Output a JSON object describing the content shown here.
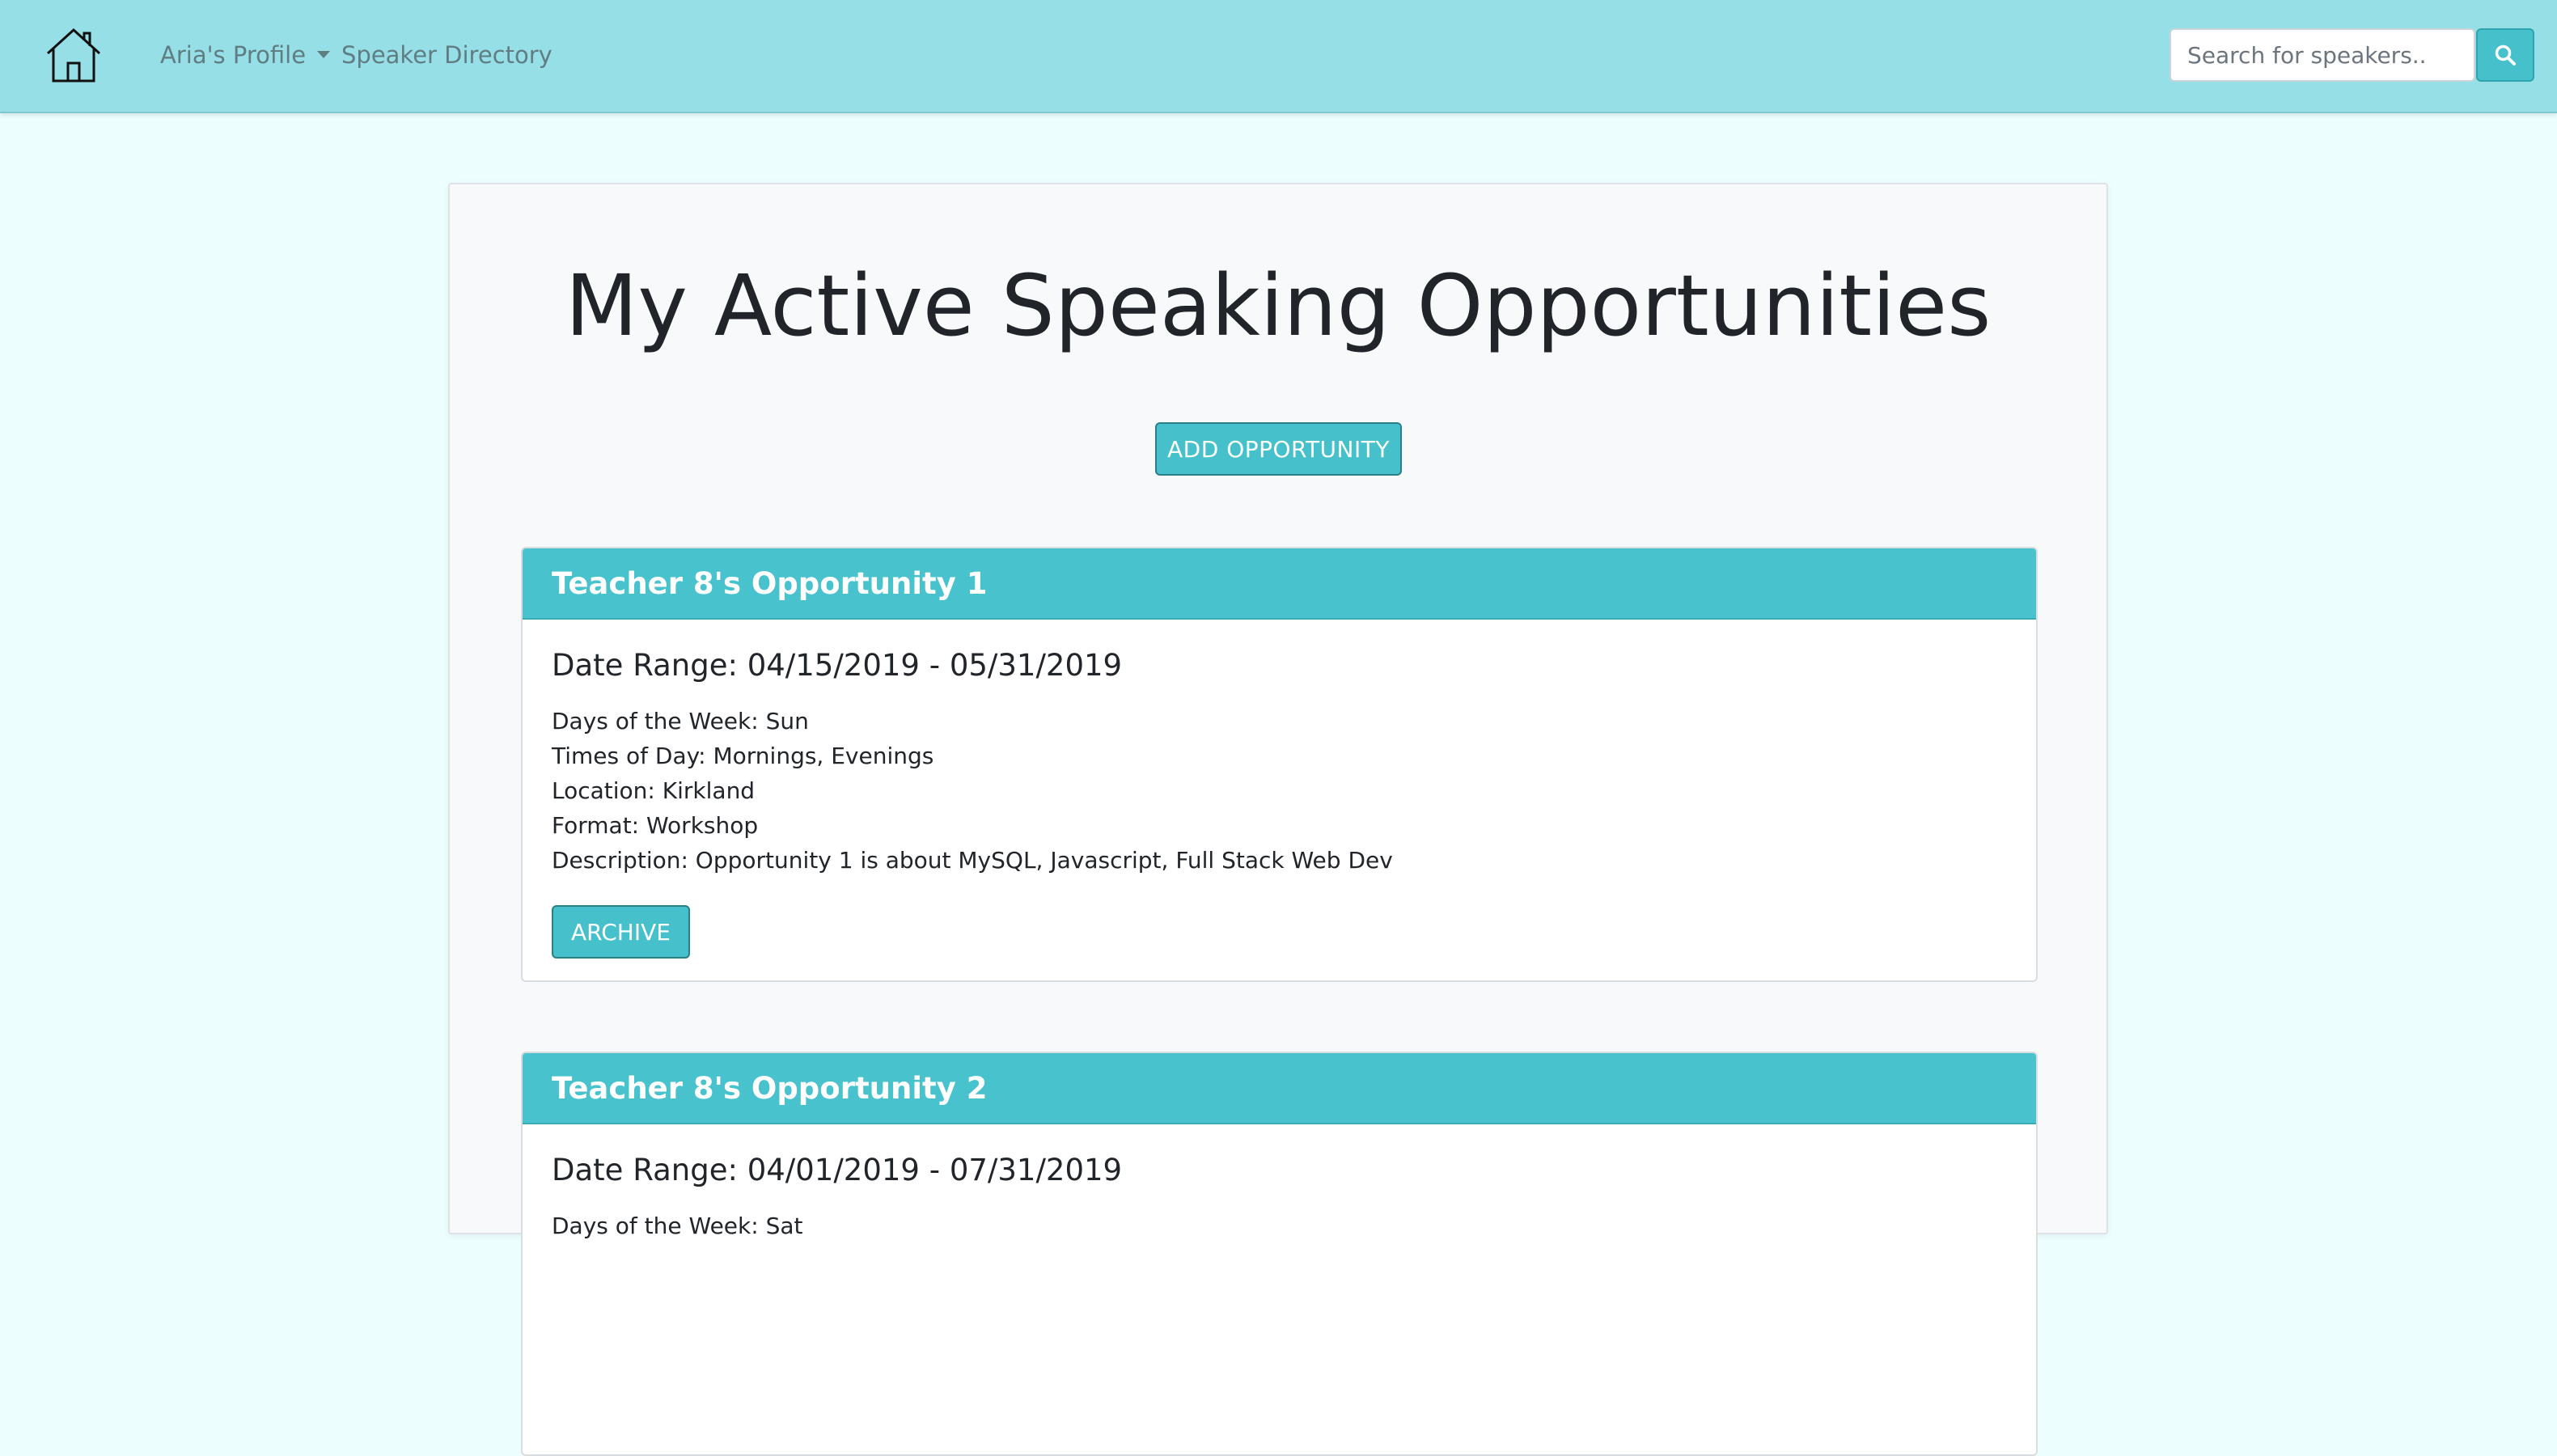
{
  "navbar": {
    "home_icon": "house-icon",
    "profile_label": "Aria's Profile",
    "directory_label": "Speaker Directory",
    "search_placeholder": "Search for speakers..",
    "search_icon": "search-icon"
  },
  "main": {
    "title": "My Active Speaking Opportunities",
    "add_button_label": "ADD OPPORTUNITY"
  },
  "opportunities": [
    {
      "title": "Teacher 8's Opportunity 1",
      "date_range": "Date Range: 04/15/2019 - 05/31/2019",
      "days": "Days of the Week: Sun",
      "times": "Times of Day: Mornings, Evenings",
      "location": "Location: Kirkland",
      "format": "Format: Workshop",
      "description": "Description: Opportunity 1 is about MySQL, Javascript, Full Stack Web Dev",
      "archive_label": "ARCHIVE"
    },
    {
      "title": "Teacher 8's Opportunity 2",
      "date_range": "Date Range: 04/01/2019 - 07/31/2019",
      "days": "Days of the Week: Sat"
    }
  ],
  "colors": {
    "navbar_bg": "#97dfe6",
    "page_bg": "#ecfefe",
    "accent": "#46c1cc",
    "panel_bg": "#f8f9fa"
  }
}
